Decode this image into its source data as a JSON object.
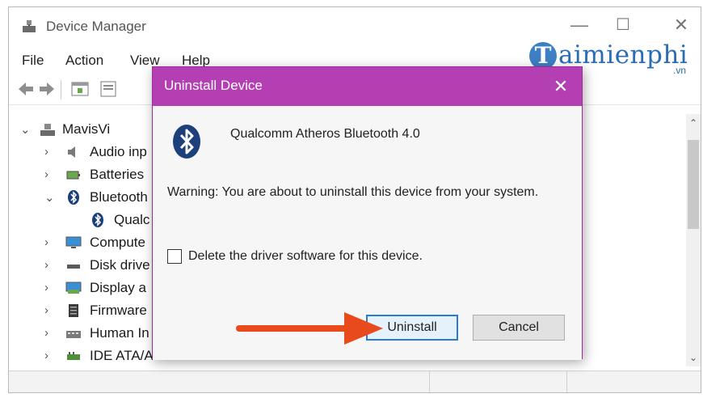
{
  "window": {
    "title": "Device Manager",
    "controls": {
      "minimize": "—",
      "maximize": "☐",
      "close": "✕"
    }
  },
  "menu": [
    "File",
    "Action",
    "View",
    "Help"
  ],
  "tree": {
    "root": "MavisVi",
    "items": [
      {
        "label": "Audio inp",
        "expanded": false
      },
      {
        "label": "Batteries",
        "expanded": false
      },
      {
        "label": "Bluetooth",
        "expanded": true
      },
      {
        "label": "Qualc",
        "child": true
      },
      {
        "label": "Compute",
        "expanded": false
      },
      {
        "label": "Disk drive",
        "expanded": false
      },
      {
        "label": "Display a",
        "expanded": false
      },
      {
        "label": "Firmware",
        "expanded": false
      },
      {
        "label": "Human In",
        "expanded": false
      },
      {
        "label": "IDE ATA/ATAPI controllers",
        "expanded": false
      }
    ]
  },
  "watermark": {
    "ball": "T",
    "text": "aimienphi",
    "sub": ".vn"
  },
  "dialog": {
    "title": "Uninstall Device",
    "close": "✕",
    "device_name": "Qualcomm Atheros Bluetooth 4.0",
    "warning": "Warning: You are about to uninstall this device from your system.",
    "checkbox_label": "Delete the driver software for this device.",
    "checkbox_checked": false,
    "uninstall_label": "Uninstall",
    "cancel_label": "Cancel"
  },
  "colors": {
    "dialog_titlebar": "#b33fb3",
    "primary_button_border": "#2a7ad6",
    "annotation_arrow": "#e84a1c",
    "watermark": "#2a6cb5"
  },
  "icons": {
    "app": "device-manager-icon",
    "back": "back-arrow-icon",
    "forward": "forward-arrow-icon",
    "bluetooth": "bluetooth-icon"
  }
}
